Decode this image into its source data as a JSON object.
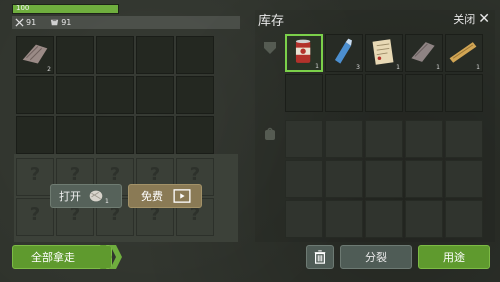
{
  "health": {
    "value": "100",
    "fraction": 1.0
  },
  "stats": {
    "attack": "91",
    "armor": "91"
  },
  "left": {
    "slot0_count": "2"
  },
  "buttons": {
    "open_label": "打开",
    "open_count": "1",
    "free_label": "免费",
    "take_all_label": "全部拿走",
    "split_label": "分裂",
    "use_label": "用途"
  },
  "storage": {
    "title": "库存",
    "close_label": "关闭",
    "items": [
      {
        "icon": "canned-food-icon",
        "count": "1"
      },
      {
        "icon": "water-bottle-icon",
        "count": "3"
      },
      {
        "icon": "paper-icon",
        "count": "1"
      },
      {
        "icon": "cloth-icon",
        "count": "1"
      },
      {
        "icon": "wood-plank-icon",
        "count": "1"
      }
    ]
  },
  "colors": {
    "accent_green": "#5f9a2e",
    "panel_bg": "#2f332c",
    "free_button": "#8a7a55"
  }
}
